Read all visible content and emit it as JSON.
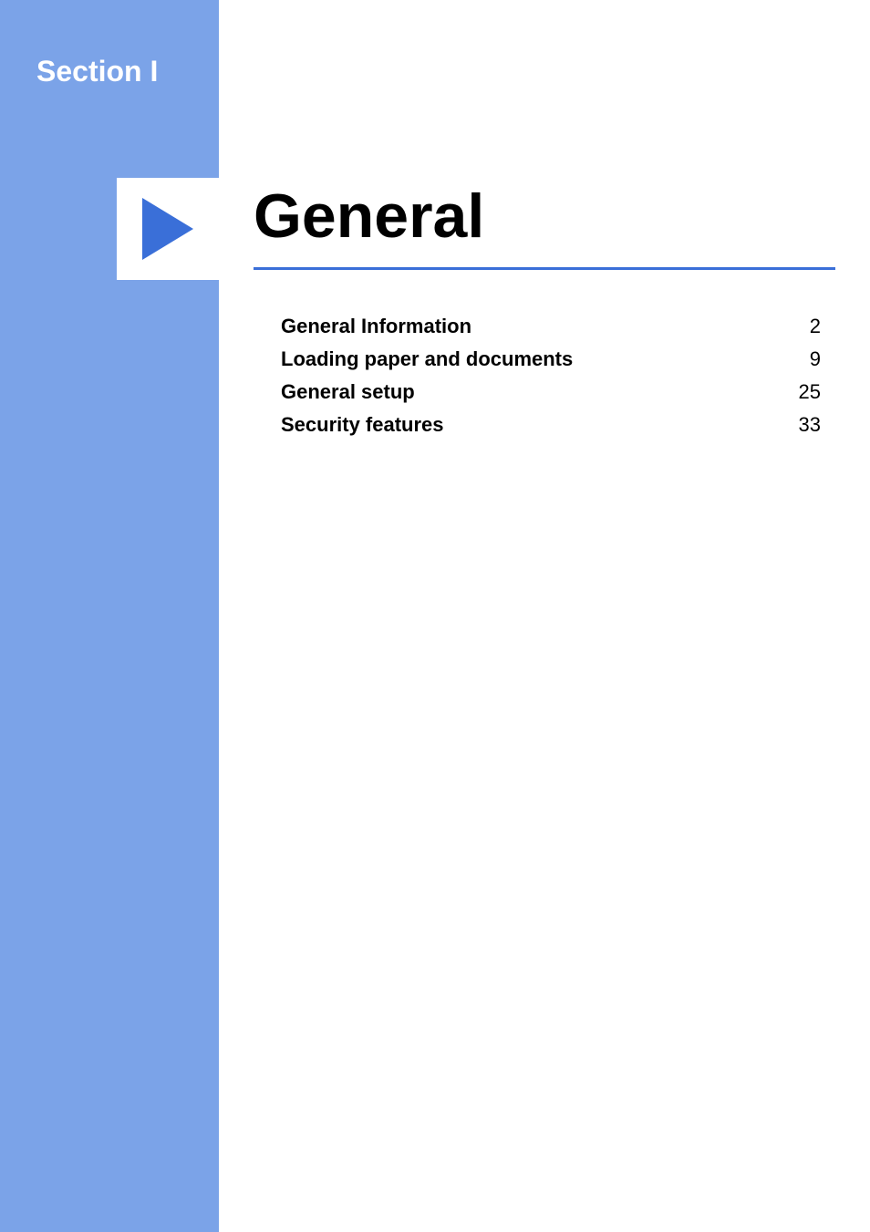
{
  "section_label": "Section I",
  "main_title": "General",
  "toc": [
    {
      "title": "General Information",
      "page": "2"
    },
    {
      "title": "Loading paper and documents",
      "page": "9"
    },
    {
      "title": "General setup",
      "page": "25"
    },
    {
      "title": "Security features",
      "page": "33"
    }
  ]
}
